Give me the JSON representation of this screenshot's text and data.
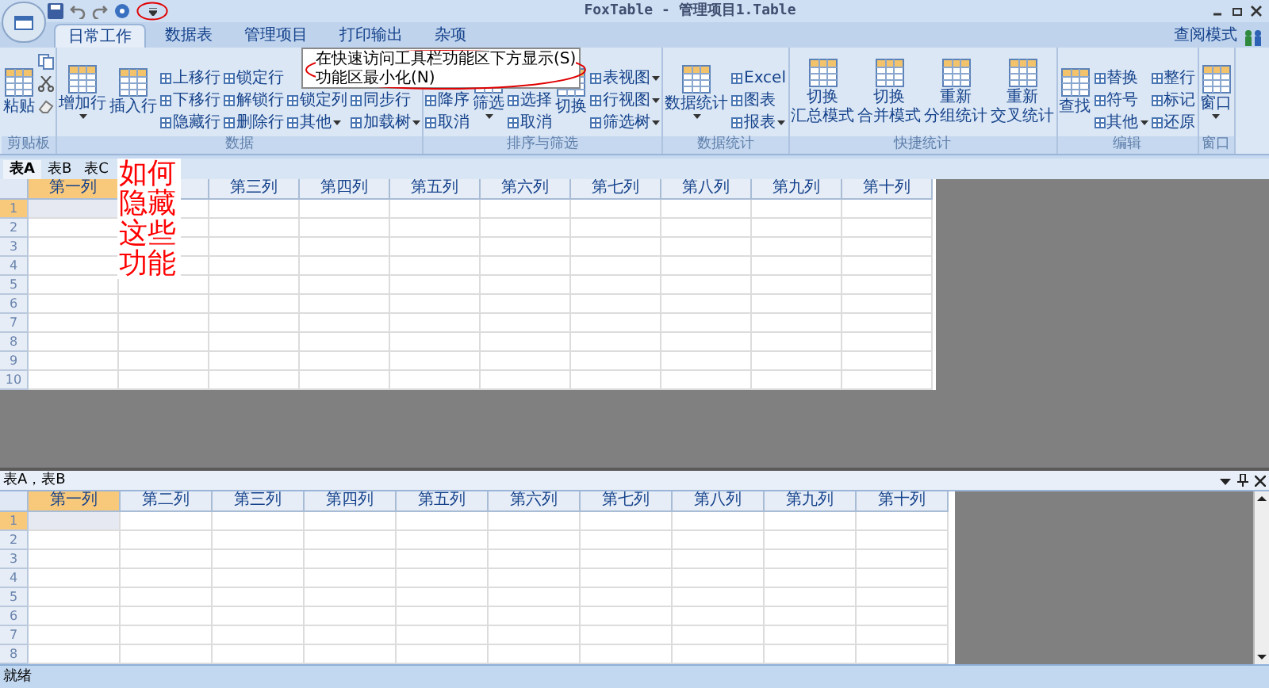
{
  "window": {
    "title": "FoxTable - 管理项目1.Table"
  },
  "tabs": [
    {
      "label": "日常工作",
      "selected": true
    },
    {
      "label": "数据表",
      "selected": false
    },
    {
      "label": "管理项目",
      "selected": false
    },
    {
      "label": "打印输出",
      "selected": false
    },
    {
      "label": "杂项",
      "selected": false
    }
  ],
  "view_mode": {
    "label": "查阅模式"
  },
  "ribbon": {
    "groups": [
      {
        "label": "剪贴板",
        "items": [
          {
            "kind": "large",
            "lines": [
              "粘贴"
            ],
            "dropdown": false
          },
          {
            "kind": "clipboard-icons"
          }
        ]
      },
      {
        "label": "数据",
        "items": [
          {
            "kind": "large",
            "lines": [
              "增加行"
            ],
            "dropdown": true
          },
          {
            "kind": "large",
            "lines": [
              "插入行"
            ],
            "dropdown": false
          },
          {
            "kind": "stack",
            "items": [
              {
                "label": "上移行",
                "dropdown": false
              },
              {
                "label": "下移行",
                "dropdown": false
              },
              {
                "label": "隐藏行",
                "dropdown": false
              }
            ]
          },
          {
            "kind": "stack",
            "items": [
              {
                "label": "锁定行",
                "dropdown": false
              },
              {
                "label": "解锁行",
                "dropdown": false
              },
              {
                "label": "删除行",
                "dropdown": false
              }
            ]
          },
          {
            "kind": "stack",
            "items": [
              {
                "label": "锁定列",
                "dropdown": false
              },
              {
                "label": "其他",
                "dropdown": true
              }
            ]
          },
          {
            "kind": "stack",
            "items": [
              {
                "label": "同步行",
                "dropdown": false
              },
              {
                "label": "加载树",
                "dropdown": true
              }
            ]
          }
        ]
      },
      {
        "label": "排序与筛选",
        "items": [
          {
            "kind": "stack",
            "items": [
              {
                "label": "降序",
                "dropdown": false
              },
              {
                "label": "取消",
                "dropdown": false
              }
            ]
          },
          {
            "kind": "large",
            "lines": [
              "筛选"
            ],
            "dropdown": true
          },
          {
            "kind": "stack",
            "items": [
              {
                "label": "选择",
                "dropdown": false
              },
              {
                "label": "取消",
                "dropdown": false
              }
            ]
          },
          {
            "kind": "large",
            "lines": [
              "切换"
            ],
            "dropdown": false
          },
          {
            "kind": "stack",
            "items": [
              {
                "label": "表视图",
                "dropdown": true
              },
              {
                "label": "行视图",
                "dropdown": true
              },
              {
                "label": "筛选树",
                "dropdown": true
              }
            ]
          }
        ]
      },
      {
        "label": "数据统计",
        "items": [
          {
            "kind": "large",
            "lines": [
              "数据统计"
            ],
            "dropdown": true
          },
          {
            "kind": "stack",
            "items": [
              {
                "label": "Excel",
                "dropdown": false
              },
              {
                "label": "图表",
                "dropdown": false
              },
              {
                "label": "报表",
                "dropdown": true
              }
            ]
          }
        ]
      },
      {
        "label": "快捷统计",
        "items": [
          {
            "kind": "large",
            "lines": [
              "切换",
              "汇总模式"
            ],
            "dropdown": false
          },
          {
            "kind": "large",
            "lines": [
              "切换",
              "合并模式"
            ],
            "dropdown": false
          },
          {
            "kind": "large",
            "lines": [
              "重新",
              "分组统计"
            ],
            "dropdown": false
          },
          {
            "kind": "large",
            "lines": [
              "重新",
              "交叉统计"
            ],
            "dropdown": false
          }
        ]
      },
      {
        "label": "编辑",
        "items": [
          {
            "kind": "large",
            "lines": [
              "查找"
            ],
            "dropdown": false
          },
          {
            "kind": "stack",
            "items": [
              {
                "label": "替换",
                "dropdown": false
              },
              {
                "label": "符号",
                "dropdown": false
              },
              {
                "label": "其他",
                "dropdown": true
              }
            ]
          },
          {
            "kind": "stack",
            "items": [
              {
                "label": "整行",
                "dropdown": false
              },
              {
                "label": "标记",
                "dropdown": false
              },
              {
                "label": "还原",
                "dropdown": false
              }
            ]
          }
        ]
      },
      {
        "label": "窗口",
        "items": [
          {
            "kind": "large",
            "lines": [
              "窗口"
            ],
            "dropdown": true
          }
        ]
      }
    ]
  },
  "menu": {
    "items": [
      {
        "label": "在快速访问工具栏功能区下方显示(S)"
      },
      {
        "label": "功能区最小化(N)"
      }
    ]
  },
  "annotation": {
    "text": "如何隐藏这些功能"
  },
  "sheet_tabs": [
    {
      "label": "表A",
      "selected": true
    },
    {
      "label": "表B",
      "selected": false
    },
    {
      "label": "表C",
      "selected": false
    }
  ],
  "grid_top": {
    "columns": [
      {
        "label": "第一列",
        "selected": true
      },
      {
        "selected": false
      },
      {
        "label": "第三列",
        "selected": false
      },
      {
        "label": "第四列",
        "selected": false
      },
      {
        "label": "第五列",
        "selected": false
      },
      {
        "label": "第六列",
        "selected": false
      },
      {
        "label": "第七列",
        "selected": false
      },
      {
        "label": "第八列",
        "selected": false
      },
      {
        "label": "第九列",
        "selected": false
      },
      {
        "label": "第十列",
        "selected": false
      }
    ],
    "rows": [
      {
        "label": "1",
        "selected": true
      },
      {
        "label": "2",
        "selected": false
      },
      {
        "label": "3",
        "selected": false
      },
      {
        "label": "4",
        "selected": false
      },
      {
        "label": "5",
        "selected": false
      },
      {
        "label": "6",
        "selected": false
      },
      {
        "label": "7",
        "selected": false
      },
      {
        "label": "8",
        "selected": false
      },
      {
        "label": "9",
        "selected": false
      },
      {
        "label": "10",
        "selected": false
      }
    ]
  },
  "panel": {
    "title": "表A，表B"
  },
  "grid_bottom": {
    "columns": [
      {
        "label": "第一列",
        "selected": true
      },
      {
        "label": "第二列",
        "selected": false
      },
      {
        "label": "第三列",
        "selected": false
      },
      {
        "label": "第四列",
        "selected": false
      },
      {
        "label": "第五列",
        "selected": false
      },
      {
        "label": "第六列",
        "selected": false
      },
      {
        "label": "第七列",
        "selected": false
      },
      {
        "label": "第八列",
        "selected": false
      },
      {
        "label": "第九列",
        "selected": false
      },
      {
        "label": "第十列",
        "selected": false
      }
    ],
    "rows": [
      {
        "label": "1",
        "selected": true
      },
      {
        "label": "2",
        "selected": false
      },
      {
        "label": "3",
        "selected": false
      },
      {
        "label": "4",
        "selected": false
      },
      {
        "label": "5",
        "selected": false
      },
      {
        "label": "6",
        "selected": false
      },
      {
        "label": "7",
        "selected": false
      },
      {
        "label": "8",
        "selected": false
      }
    ]
  },
  "status_bar": {
    "text": "就绪"
  }
}
